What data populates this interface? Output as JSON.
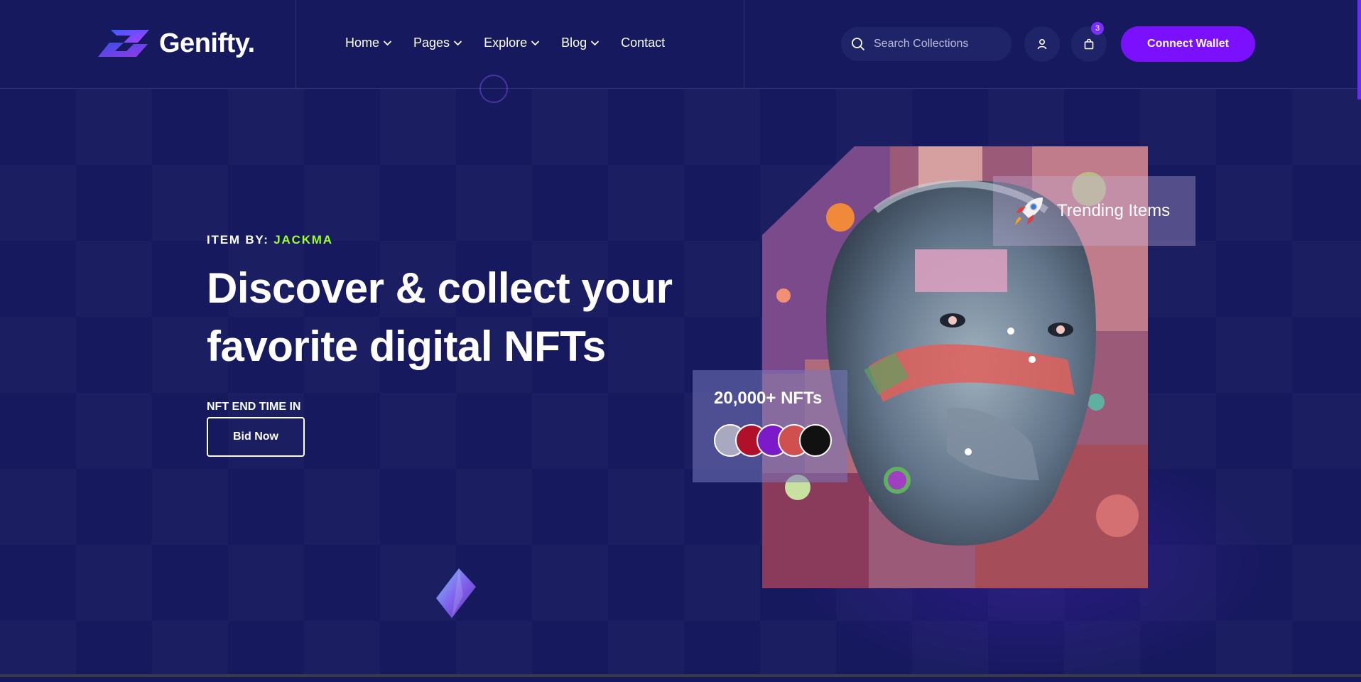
{
  "brand": {
    "name": "Genifty."
  },
  "nav": {
    "items": [
      {
        "label": "Home",
        "has_dropdown": true
      },
      {
        "label": "Pages",
        "has_dropdown": true
      },
      {
        "label": "Explore",
        "has_dropdown": true
      },
      {
        "label": "Blog",
        "has_dropdown": true
      },
      {
        "label": "Contact",
        "has_dropdown": false
      }
    ]
  },
  "search": {
    "placeholder": "Search Collections",
    "icon": "search-icon"
  },
  "header_actions": {
    "user_icon": "user-icon",
    "cart_icon": "shopping-bag-icon",
    "cart_count": "3",
    "connect_label": "Connect Wallet"
  },
  "hero": {
    "item_by_prefix": "ITEM BY:",
    "item_by_author": "JACKMA",
    "headline_line1": "Discover & collect your",
    "headline_line2": "favorite digital NFTs",
    "end_time_label": "NFT END TIME IN",
    "bid_label": "Bid Now"
  },
  "artwork": {
    "trending_label": "Trending Items",
    "trending_icon": "rocket-icon",
    "nft_count": "20,000+ NFTs"
  },
  "colors": {
    "background": "#16195e",
    "accent": "#7b10ff",
    "author_highlight": "#9cff2e"
  }
}
